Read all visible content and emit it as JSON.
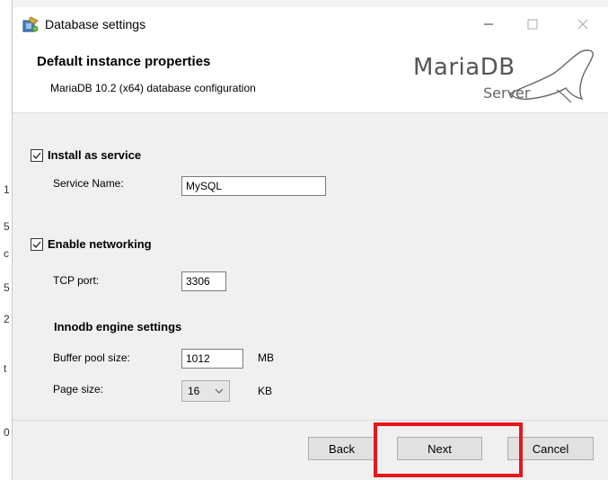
{
  "window": {
    "title": "Database settings",
    "minimize_glyph": "—",
    "maximize_glyph": "☐",
    "close_glyph": "✕"
  },
  "header": {
    "title": "Default instance properties",
    "subtitle": "MariaDB 10.2 (x64) database configuration",
    "logo_main": "MariaDB",
    "logo_sub": "Server"
  },
  "service": {
    "checkbox_label": "Install as service",
    "checked": true,
    "name_label": "Service Name:",
    "name_value": "MySQL"
  },
  "networking": {
    "checkbox_label": "Enable networking",
    "checked": true,
    "port_label": "TCP port:",
    "port_value": "3306"
  },
  "innodb": {
    "section_title": "Innodb engine settings",
    "buffer_label": "Buffer pool size:",
    "buffer_value": "1012",
    "buffer_unit": "MB",
    "page_label": "Page size:",
    "page_value": "16",
    "page_unit": "KB"
  },
  "buttons": {
    "back": "Back",
    "next": "Next",
    "cancel": "Cancel"
  },
  "colors": {
    "highlight": "#e8161b",
    "accent": "#0078d7"
  },
  "background_window": {
    "chars": [
      "1",
      "5",
      "c",
      "5",
      "2",
      "t",
      "0"
    ]
  }
}
